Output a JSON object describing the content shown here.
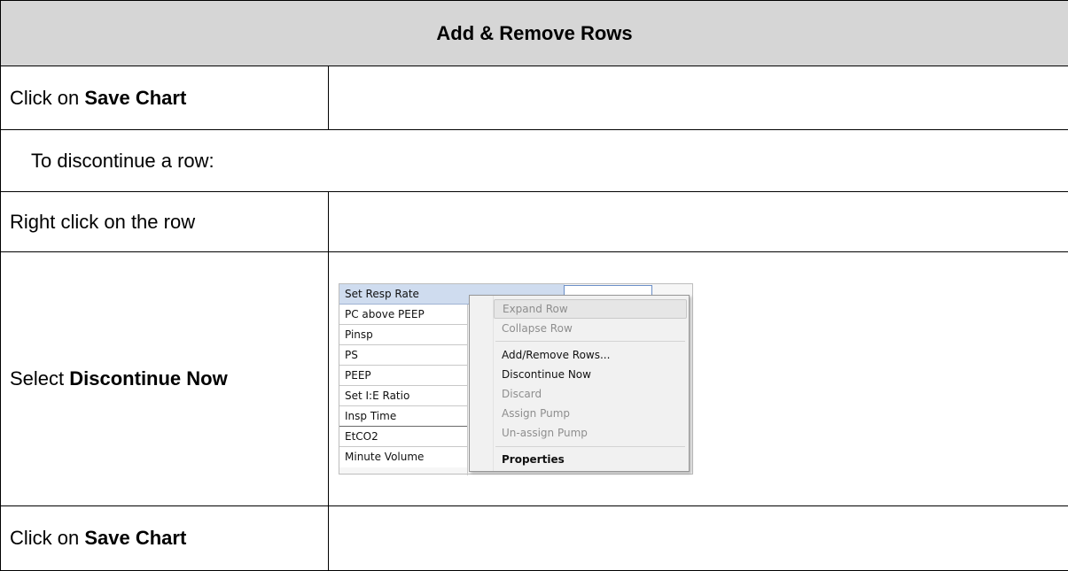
{
  "header": {
    "title": "Add & Remove Rows"
  },
  "steps": [
    {
      "text": "Click on ",
      "bold": "Save Chart"
    },
    {
      "text": "To discontinue a row:"
    },
    {
      "text": "Right click on the row"
    },
    {
      "text": "Select ",
      "bold": "Discontinue Now"
    },
    {
      "text": "Click on ",
      "bold": "Save Chart"
    }
  ],
  "screenshot": {
    "rows": [
      "Set Resp Rate",
      "PC above PEEP",
      "Pinsp",
      "PS",
      "PEEP",
      "Set I:E Ratio",
      "Insp Time",
      "EtCO2",
      "Minute Volume"
    ],
    "menu": [
      {
        "label": "Expand Row",
        "state": "disabled"
      },
      {
        "label": "Collapse Row",
        "state": "disabled"
      },
      {
        "label": "Add/Remove Rows...",
        "state": "enabled"
      },
      {
        "label": "Discontinue Now",
        "state": "enabled"
      },
      {
        "label": "Discard",
        "state": "disabled"
      },
      {
        "label": "Assign Pump",
        "state": "disabled"
      },
      {
        "label": "Un-assign Pump",
        "state": "disabled"
      },
      {
        "label": "Properties",
        "state": "bold"
      }
    ]
  },
  "colors": {
    "header_bg": "#d6d6d6",
    "selection": "#cfdcef",
    "menu_bg": "#f1f1f1"
  }
}
